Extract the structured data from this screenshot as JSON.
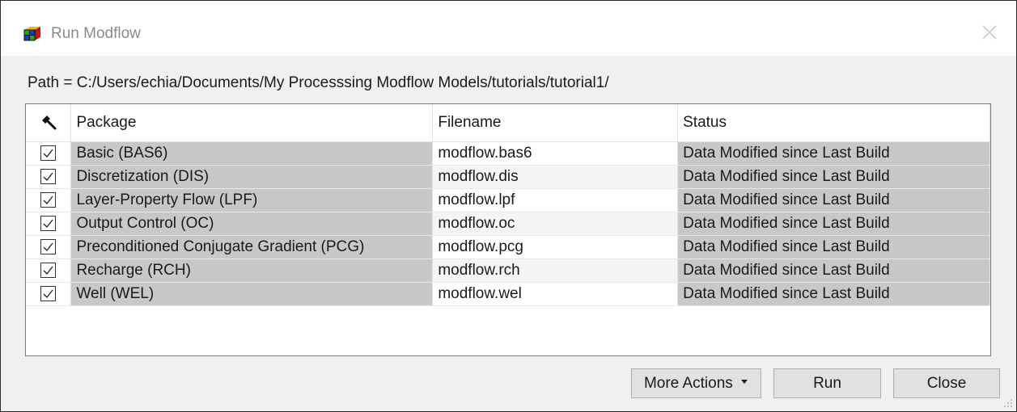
{
  "window": {
    "title": "Run Modflow",
    "path_label": "Path = C:/Users/echia/Documents/My Processsing Modflow Models/tutorials/tutorial1/"
  },
  "table": {
    "columns": {
      "build": "build-hammer-icon",
      "package": "Package",
      "filename": "Filename",
      "status": "Status"
    },
    "rows": [
      {
        "checked": true,
        "package": "Basic (BAS6)",
        "filename": "modflow.bas6",
        "status": "Data Modified since Last Build"
      },
      {
        "checked": true,
        "package": "Discretization (DIS)",
        "filename": "modflow.dis",
        "status": "Data Modified since Last Build"
      },
      {
        "checked": true,
        "package": "Layer-Property Flow (LPF)",
        "filename": "modflow.lpf",
        "status": "Data Modified since Last Build"
      },
      {
        "checked": true,
        "package": "Output Control (OC)",
        "filename": "modflow.oc",
        "status": "Data Modified since Last Build"
      },
      {
        "checked": true,
        "package": "Preconditioned Conjugate Gradient (PCG)",
        "filename": "modflow.pcg",
        "status": "Data Modified since Last Build"
      },
      {
        "checked": true,
        "package": "Recharge (RCH)",
        "filename": "modflow.rch",
        "status": "Data Modified since Last Build"
      },
      {
        "checked": true,
        "package": "Well (WEL)",
        "filename": "modflow.wel",
        "status": "Data Modified since Last Build"
      }
    ]
  },
  "buttons": {
    "more_actions": "More Actions",
    "more_actions_icon": "dropdown-triangle-icon",
    "run": "Run",
    "close": "Close"
  },
  "colors": {
    "highlight_cell": "#c8c8c8",
    "window_bg": "#f0f0f0",
    "button_bg": "#e1e1e1"
  }
}
